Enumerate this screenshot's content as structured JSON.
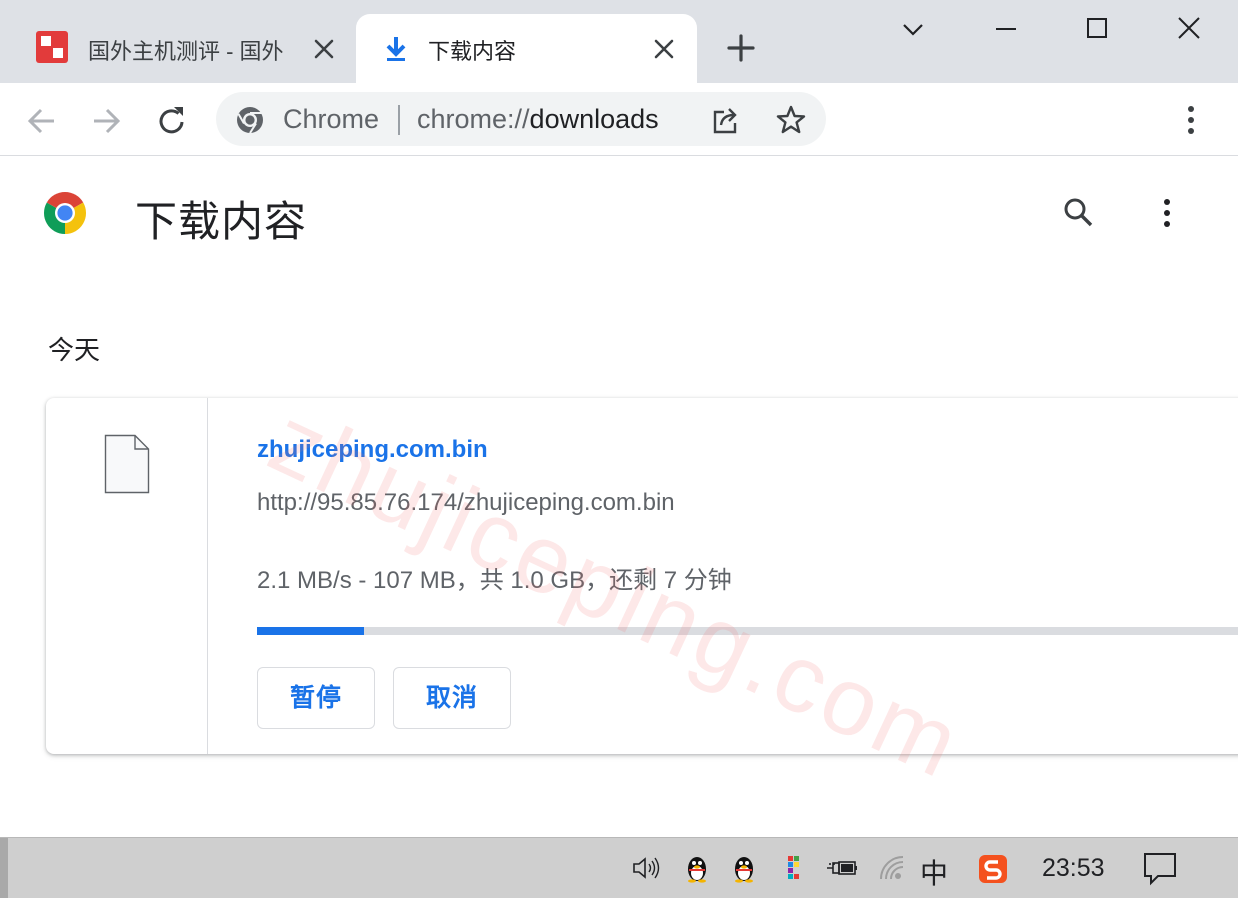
{
  "tabs": [
    {
      "title": "国外主机测评 - 国外",
      "active": false
    },
    {
      "title": "下载内容",
      "active": true
    }
  ],
  "omnibox": {
    "scheme_label": "Chrome",
    "url_prefix": "chrome://",
    "url_host": "downloads"
  },
  "page": {
    "title": "下载内容"
  },
  "section": {
    "date_label": "今天"
  },
  "download": {
    "file_name": "zhujiceping.com.bin",
    "url": "http://95.85.76.174/zhujiceping.com.bin",
    "status": "2.1 MB/s - 107 MB，共 1.0 GB，还剩 7 分钟",
    "progress_fraction": 0.107,
    "pause_label": "暂停",
    "cancel_label": "取消"
  },
  "watermark": "zhujiceping.com",
  "taskbar": {
    "time": "23:53",
    "ime_label": "中"
  },
  "colors": {
    "accent": "#1a73e8",
    "tab_strip": "#dee1e6",
    "omnibox": "#f1f3f4",
    "watermark": "#f46e6e"
  }
}
